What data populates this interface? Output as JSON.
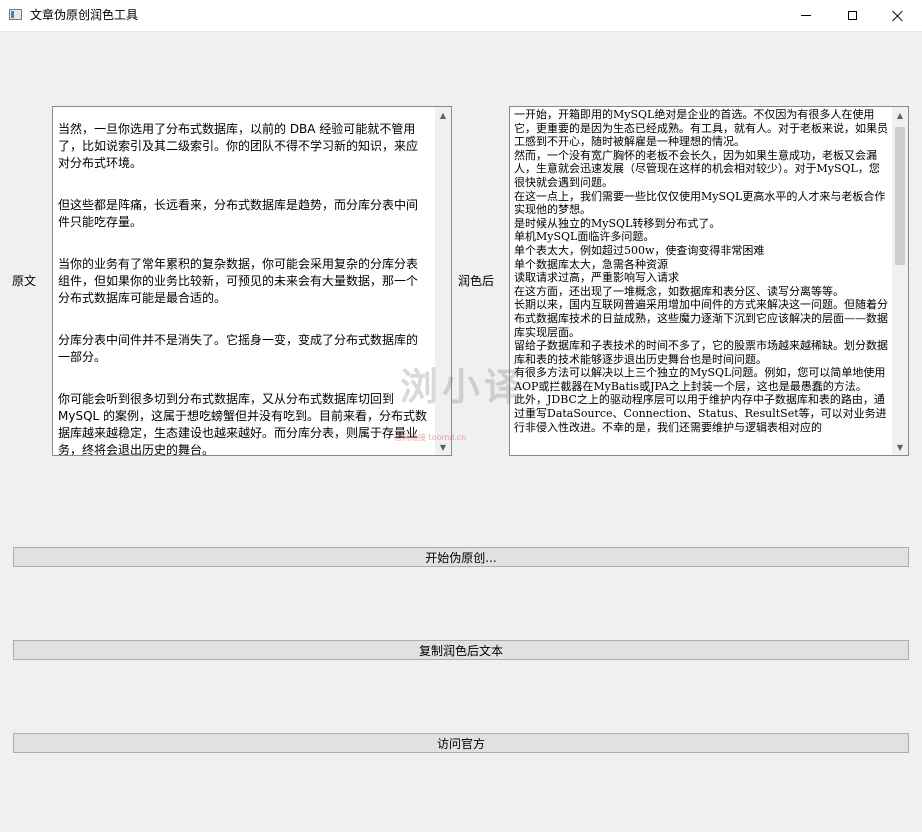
{
  "window": {
    "title": "文章伪原创润色工具",
    "icons": {
      "app": "app-window-icon",
      "minimize": "minimize-icon",
      "maximize": "maximize-icon",
      "close": "close-icon"
    }
  },
  "labels": {
    "original": "原文",
    "polished": "润色后"
  },
  "original_text": {
    "paragraphs": [
      "当然，一旦你选用了分布式数据库，以前的 DBA 经验可能就不管用了，比如说索引及其二级索引。你的团队不得不学习新的知识，来应对分布式环境。",
      "但这些都是阵痛，长远看来，分布式数据库是趋势，而分库分表中间件只能吃存量。",
      "当你的业务有了常年累积的复杂数据，你可能会采用复杂的分库分表组件，但如果你的业务比较新，可预见的未来会有大量数据，那一个分布式数据库可能是最合适的。",
      "分库分表中间件并不是消失了。它摇身一变，变成了分布式数据库的一部分。",
      "你可能会听到很多切到分布式数据库，又从分布式数据库切回到 MySQL 的案例，这属于想吃螃蟹但并没有吃到。目前来看，分布式数据库越来越稳定，生态建设也越来越好。而分库分表，则属于存量业务，终将会退出历史的舞台。"
    ]
  },
  "polished_text": {
    "lines": [
      "一开始，开箱即用的MySQL绝对是企业的首选。不仅因为有很多人在使用它，更重要的是因为生态已经成熟。有工具，就有人。对于老板来说，如果员工感到不开心，随时被解雇是一种理想的情况。",
      "然而，一个没有宽广胸怀的老板不会长久，因为如果生意成功，老板又会漏人，生意就会迅速发展（尽管现在这样的机会相对较少）。对于MySQL，您很快就会遇到问题。",
      "在这一点上，我们需要一些比仅仅使用MySQL更高水平的人才来与老板合作实现他的梦想。",
      "是时候从独立的MySQL转移到分布式了。",
      "单机MySQL面临许多问题。",
      "单个表太大，例如超过500w，使查询变得非常困难",
      "单个数据库太大，急需各种资源",
      "读取请求过高，严重影响写入请求",
      "在这方面，还出现了一堆概念，如数据库和表分区、读写分离等等。",
      "长期以来，国内互联网普遍采用增加中间件的方式来解决这一问题。但随着分布式数据库技术的日益成熟，这些魔力逐渐下沉到它应该解决的层面——数据库实现层面。",
      "留给子数据库和子表技术的时间不多了，它的股票市场越来越稀缺。划分数据库和表的技术能够逐步退出历史舞台也是时间问题。",
      "有很多方法可以解决以上三个独立的MySQL问题。例如，您可以简单地使用AOP或拦截器在MyBatis或JPA之上封装一个层，这也是最愚蠢的方法。",
      "此外，JDBC之上的驱动程序层可以用于维护内存中子数据库和表的路由，通过重写DataSource、Connection、Status、ResultSet等，可以对业务进行非侵入性改进。不幸的是，我们还需要维护与逻辑表相对应的"
    ]
  },
  "watermark": {
    "main": "浏小译",
    "sub": "官网链接 toomd.cn"
  },
  "buttons": {
    "start": "开始伪原创...",
    "copy": "复制润色后文本",
    "visit": "访问官方"
  },
  "scroll_icons": {
    "up": "scroll-up-arrow-icon",
    "down": "scroll-down-arrow-icon"
  }
}
